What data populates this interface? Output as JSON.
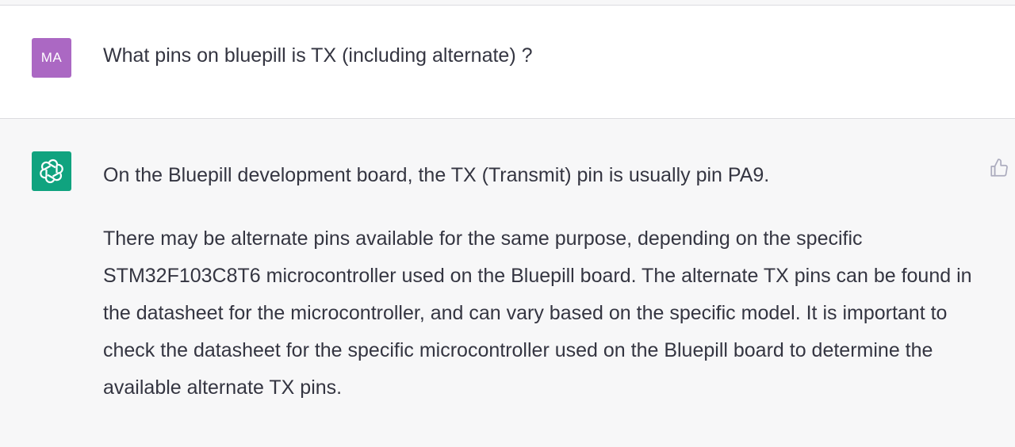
{
  "user_message": {
    "avatar_initials": "MA",
    "avatar_color": "#ab68c3",
    "text": "What pins on bluepill is TX (including alternate) ?"
  },
  "assistant_message": {
    "avatar_icon": "openai-logo-icon",
    "avatar_color": "#10a37f",
    "paragraphs": [
      "On the Bluepill development board, the TX (Transmit) pin is usually pin PA9.",
      "There may be alternate pins available for the same purpose, depending on the specific STM32F103C8T6 microcontroller used on the Bluepill board. The alternate TX pins can be found in the datasheet for the microcontroller, and can vary based on the specific model. It is important to check the datasheet for the specific microcontroller used on the Bluepill board to determine the available alternate TX pins."
    ],
    "feedback_icon": "thumbs-up-icon"
  },
  "colors": {
    "user_row_bg": "#ffffff",
    "assistant_row_bg": "#f7f7f8",
    "text": "#343541",
    "divider": "#dcdce0"
  }
}
